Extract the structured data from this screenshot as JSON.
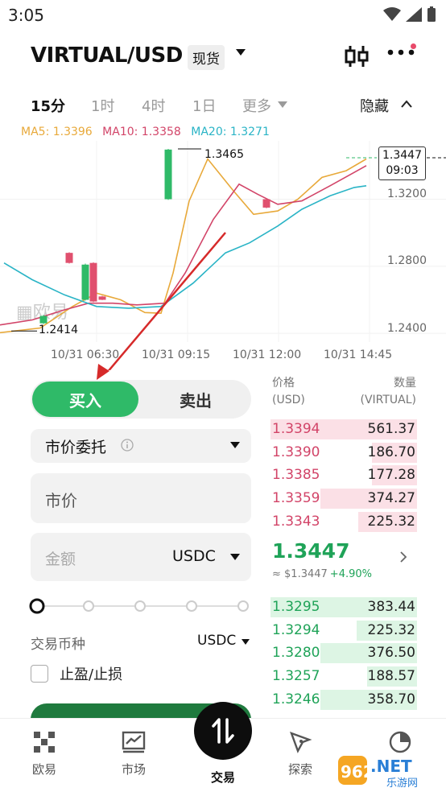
{
  "status": {
    "time": "3:05"
  },
  "header": {
    "pair": "VIRTUAL/USD",
    "market_type": "现货"
  },
  "timeframes": {
    "items": [
      "15分",
      "1时",
      "4时",
      "1日",
      "更多"
    ],
    "active": "15分",
    "hide_label": "隐藏"
  },
  "ma": {
    "ma5": "MA5: 1.3396",
    "ma10": "MA10: 1.3358",
    "ma20": "MA20: 1.3271",
    "colors": {
      "ma5": "#e8a93a",
      "ma10": "#d24468",
      "ma20": "#2ab4c6"
    }
  },
  "chart_data": {
    "type": "candlestick",
    "y_ticks": [
      "1.3200",
      "1.2800",
      "1.2400"
    ],
    "x_ticks": [
      "10/31 06:30",
      "10/31 09:15",
      "10/31 12:00",
      "10/31 14:45"
    ],
    "high_label": "1.3465",
    "low_label": "1.2414",
    "current_price": "1.3447",
    "current_countdown": "09:03",
    "ylim": [
      1.2372,
      1.3548
    ],
    "candles": [
      {
        "x": 54,
        "o": 1.246,
        "c": 1.2504,
        "h": 1.251,
        "l": 1.2456,
        "up": true
      },
      {
        "x": 86,
        "o": 1.288,
        "c": 1.282,
        "h": 1.2884,
        "l": 1.2816,
        "up": false
      },
      {
        "x": 106,
        "o": 1.26,
        "c": 1.281,
        "h": 1.2816,
        "l": 1.2596,
        "up": true
      },
      {
        "x": 116,
        "o": 1.282,
        "c": 1.259,
        "h": 1.2824,
        "l": 1.2586,
        "up": false
      },
      {
        "x": 127,
        "o": 1.262,
        "c": 1.26,
        "h": 1.2624,
        "l": 1.2598,
        "up": false
      },
      {
        "x": 209,
        "o": 1.32,
        "c": 1.3496,
        "h": 1.35,
        "l": 1.3196,
        "up": true
      },
      {
        "x": 331,
        "o": 1.32,
        "c": 1.315,
        "h": 1.3204,
        "l": 1.3146,
        "up": false
      }
    ],
    "series": [
      {
        "name": "MA5",
        "color": "#e8a93a",
        "points": [
          [
            0,
            1.2404
          ],
          [
            50,
            1.2432
          ],
          [
            90,
            1.256
          ],
          [
            120,
            1.264
          ],
          [
            150,
            1.26
          ],
          [
            180,
            1.2524
          ],
          [
            200,
            1.252
          ],
          [
            215,
            1.276
          ],
          [
            235,
            1.319
          ],
          [
            258,
            1.344
          ],
          [
            290,
            1.325
          ],
          [
            315,
            1.311
          ],
          [
            345,
            1.313
          ],
          [
            370,
            1.32
          ],
          [
            400,
            1.333
          ],
          [
            430,
            1.337
          ],
          [
            455,
            1.344
          ]
        ]
      },
      {
        "name": "MA10",
        "color": "#d24468",
        "points": [
          [
            0,
            1.245
          ],
          [
            40,
            1.248
          ],
          [
            80,
            1.254
          ],
          [
            110,
            1.258
          ],
          [
            140,
            1.258
          ],
          [
            170,
            1.257
          ],
          [
            205,
            1.258
          ],
          [
            230,
            1.276
          ],
          [
            265,
            1.308
          ],
          [
            297,
            1.329
          ],
          [
            320,
            1.323
          ],
          [
            345,
            1.317
          ],
          [
            375,
            1.319
          ],
          [
            410,
            1.328
          ],
          [
            440,
            1.336
          ],
          [
            455,
            1.34
          ]
        ]
      },
      {
        "name": "MA20",
        "color": "#2ab4c6",
        "points": [
          [
            5,
            1.282
          ],
          [
            40,
            1.272
          ],
          [
            80,
            1.263
          ],
          [
            120,
            1.256
          ],
          [
            160,
            1.255
          ],
          [
            200,
            1.256
          ],
          [
            240,
            1.27
          ],
          [
            280,
            1.288
          ],
          [
            310,
            1.294
          ],
          [
            345,
            1.304
          ],
          [
            375,
            1.314
          ],
          [
            410,
            1.322
          ],
          [
            440,
            1.327
          ],
          [
            455,
            1.328
          ]
        ]
      }
    ]
  },
  "order": {
    "buy": "买入",
    "sell": "卖出",
    "order_type": "市价委托",
    "price": "市价",
    "amount_placeholder": "金额",
    "amount_unit": "USDC",
    "coin_label": "交易币种",
    "coin_value": "USDC",
    "tpsl": "止盈/止损"
  },
  "orderbook": {
    "price_header": "价格\n(USD)",
    "qty_header": "数量\n(VIRTUAL)",
    "asks": [
      {
        "price": "1.3394",
        "qty": "561.37",
        "depth": 1.0
      },
      {
        "price": "1.3390",
        "qty": "186.70",
        "depth": 0.31
      },
      {
        "price": "1.3385",
        "qty": "177.28",
        "depth": 0.31
      },
      {
        "price": "1.3359",
        "qty": "374.27",
        "depth": 0.66
      },
      {
        "price": "1.3343",
        "qty": "225.32",
        "depth": 0.4
      }
    ],
    "last_price": "1.3447",
    "usd_value": "≈ $1.3447",
    "change": "+4.90%",
    "bids": [
      {
        "price": "1.3295",
        "qty": "383.44",
        "depth": 1.0
      },
      {
        "price": "1.3294",
        "qty": "225.32",
        "depth": 0.41
      },
      {
        "price": "1.3280",
        "qty": "376.50",
        "depth": 0.66
      },
      {
        "price": "1.3257",
        "qty": "188.57",
        "depth": 0.34
      },
      {
        "price": "1.3246",
        "qty": "358.70",
        "depth": 0.66
      }
    ]
  },
  "nav": {
    "items": [
      "欧易",
      "市场",
      "交易",
      "探索",
      "资产"
    ],
    "active": "交易"
  },
  "watermark": {
    "text1": "962",
    "text2": ".NET",
    "text3": "乐游网"
  }
}
